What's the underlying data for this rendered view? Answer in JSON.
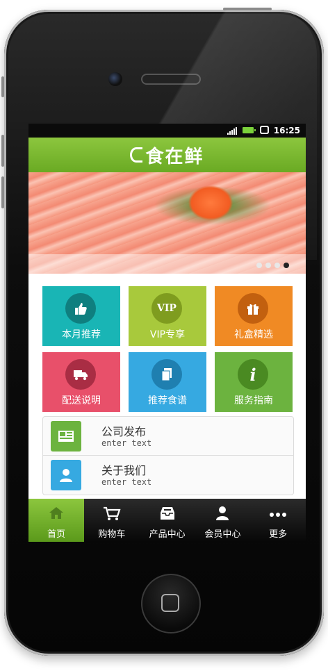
{
  "header": {
    "logo_text": "食在鲜"
  },
  "statusbar": {
    "time": "16:25"
  },
  "banner": {
    "slides_total": 4,
    "active_slide": 4
  },
  "tiles": [
    {
      "label": "本月推荐",
      "icon": "thumbs-up-icon",
      "color": "#19b5b5"
    },
    {
      "label": "VIP专享",
      "icon": "vip-icon",
      "icon_text": "VIP",
      "color": "#a8c93c"
    },
    {
      "label": "礼盒精选",
      "icon": "gift-icon",
      "color": "#f08a24"
    },
    {
      "label": "配送说明",
      "icon": "delivery-truck-icon",
      "color": "#e8506a"
    },
    {
      "label": "推荐食谱",
      "icon": "recipe-document-icon",
      "color": "#36a9e1"
    },
    {
      "label": "服务指南",
      "icon": "info-icon",
      "icon_text": "i",
      "color": "#6cb33f"
    }
  ],
  "list": [
    {
      "title": "公司发布",
      "subtitle": "enter text",
      "icon": "newspaper-icon",
      "color": "#6cb33f"
    },
    {
      "title": "关于我们",
      "subtitle": "enter text",
      "icon": "person-icon",
      "color": "#36a9e1"
    }
  ],
  "tabbar": [
    {
      "label": "首页",
      "icon": "home-icon",
      "active": true
    },
    {
      "label": "购物车",
      "icon": "cart-icon",
      "active": false
    },
    {
      "label": "产品中心",
      "icon": "inbox-tray-icon",
      "active": false
    },
    {
      "label": "会员中心",
      "icon": "user-icon",
      "active": false
    },
    {
      "label": "更多",
      "icon": "more-dots-icon",
      "active": false
    }
  ]
}
